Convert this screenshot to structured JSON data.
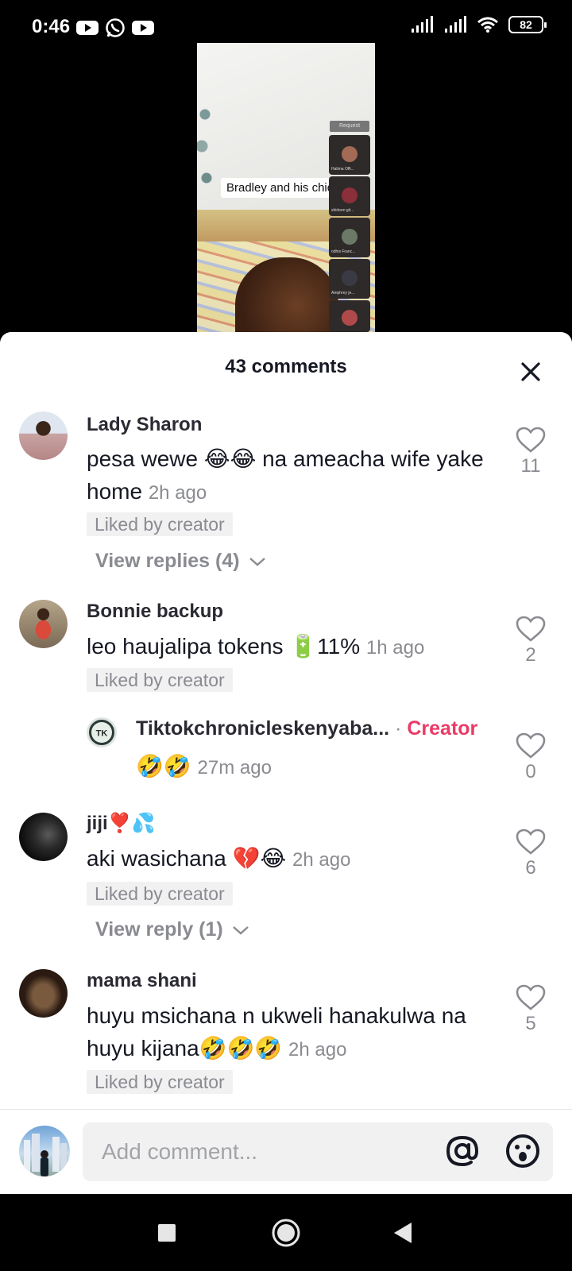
{
  "status_bar": {
    "time": "0:46",
    "app_icons": [
      "youtube-icon",
      "whatsapp-icon",
      "youtube-icon"
    ],
    "battery": "82"
  },
  "video": {
    "caption": "Bradley and his chic",
    "request_label": "Request",
    "request_cards": [
      "Halima Offi...",
      "shirleen git...",
      "odhis Franc...",
      "Amphrey je...",
      ""
    ]
  },
  "sheet": {
    "title": "43 comments"
  },
  "comments": [
    {
      "username": "Lady Sharon",
      "text": "pesa wewe 😂😂 na ameacha wife yake home",
      "time": "2h ago",
      "liked_by": "Liked by creator",
      "likes": "11",
      "view_replies": "View replies (4)"
    },
    {
      "username": "Bonnie backup",
      "text": "leo haujalipa tokens 🔋11%",
      "time": "1h ago",
      "liked_by": "Liked by creator",
      "likes": "2"
    },
    {
      "username": "Tiktokchronicleskenyaba...",
      "separator": "·",
      "creator_label": "Creator",
      "text": "🤣🤣",
      "time": "27m ago",
      "likes": "0"
    },
    {
      "username": "jiji❣️💦",
      "text": "aki wasichana 💔😂",
      "time": "2h ago",
      "liked_by": "Liked by creator",
      "likes": "6",
      "view_replies": "View reply (1)"
    },
    {
      "username": "mama  shani",
      "text": "huyu msichana n ukweli hanakulwa na huyu kijana🤣🤣🤣",
      "time": "2h ago",
      "liked_by": "Liked by creator",
      "likes": "5"
    }
  ],
  "composer": {
    "placeholder": "Add comment..."
  },
  "colors": {
    "creator": "#e93b67",
    "secondary_text": "#8a8b91",
    "liked_badge_bg": "#f1f1f2"
  }
}
